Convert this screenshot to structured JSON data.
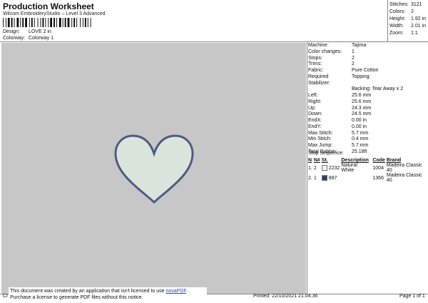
{
  "header": {
    "title": "Production Worksheet",
    "subtitle": "Wilcom EmbroideryStudio – Level 3 Advanced",
    "design_label": "Design:",
    "design_value": "LOVE 2 in",
    "colorway_label": "Colorway:",
    "colorway_value": "Colorway 1"
  },
  "stats": [
    {
      "label": "Stitches:",
      "value": "3121"
    },
    {
      "label": "Colors:",
      "value": "2"
    },
    {
      "label": "Height:",
      "value": "1.92 in"
    },
    {
      "label": "Width:",
      "value": "2.01 in"
    },
    {
      "label": "Zoom:",
      "value": "1:1"
    }
  ],
  "details": [
    {
      "label": "Machine:",
      "value": "Tajima"
    },
    {
      "label": "Color changes:",
      "value": "1"
    },
    {
      "label": "Stops:",
      "value": "2"
    },
    {
      "label": "Trims:",
      "value": "2"
    },
    {
      "label": "Fabric:",
      "value": "Pure Cotton"
    },
    {
      "label": "Required Stabilizer:",
      "value": "Topping:"
    },
    {
      "label": "",
      "value": "Backing: Tear Away x 2"
    },
    {
      "label": "Left:",
      "value": "25.6 mm"
    },
    {
      "label": "Right:",
      "value": "25.6 mm"
    },
    {
      "label": "Up:",
      "value": "24.3 mm"
    },
    {
      "label": "Down:",
      "value": "24.5 mm"
    },
    {
      "label": "EndX:",
      "value": "0.00 in"
    },
    {
      "label": "EndY:",
      "value": "0.00 in"
    },
    {
      "label": "Max Stitch:",
      "value": "5.7 mm"
    },
    {
      "label": "Min Stitch:",
      "value": "0.4 mm"
    },
    {
      "label": "Max Jump:",
      "value": "5.7 mm"
    },
    {
      "label": "Total Bobbin:",
      "value": "25.18ft"
    }
  ],
  "stop_sequence": {
    "title": "Stop Sequence:",
    "headers": [
      "N",
      "N#",
      "St.",
      "Description",
      "Code",
      "Brand"
    ],
    "rows": [
      {
        "n": "1.",
        "num": "2",
        "swatch_color": "#f2f2ec",
        "st": "2232",
        "description": "Natural White",
        "code": "1004",
        "brand": "Madeira Classic 40"
      },
      {
        "n": "2.",
        "num": "1",
        "swatch_color": "#333b6e",
        "st": "887",
        "description": "",
        "code": "1366",
        "brand": "Madeira Classic 40"
      }
    ]
  },
  "design_preview": {
    "fill_color": "#dfe8df",
    "outline_color": "#4e5b85"
  },
  "footer": {
    "left": "Cr",
    "printed": "Printed: 22/10/2021 21.04.36",
    "page": "Page 1 of 1"
  },
  "notice": {
    "text1": "This document was created by an application that isn't licensed to use ",
    "link": "novaPDF",
    "text2": ".",
    "line2": "Purchase a license to generate PDF files without this notice."
  },
  "colors": {
    "canvas_bg": "#c7c7c7",
    "rule": "#888888"
  }
}
